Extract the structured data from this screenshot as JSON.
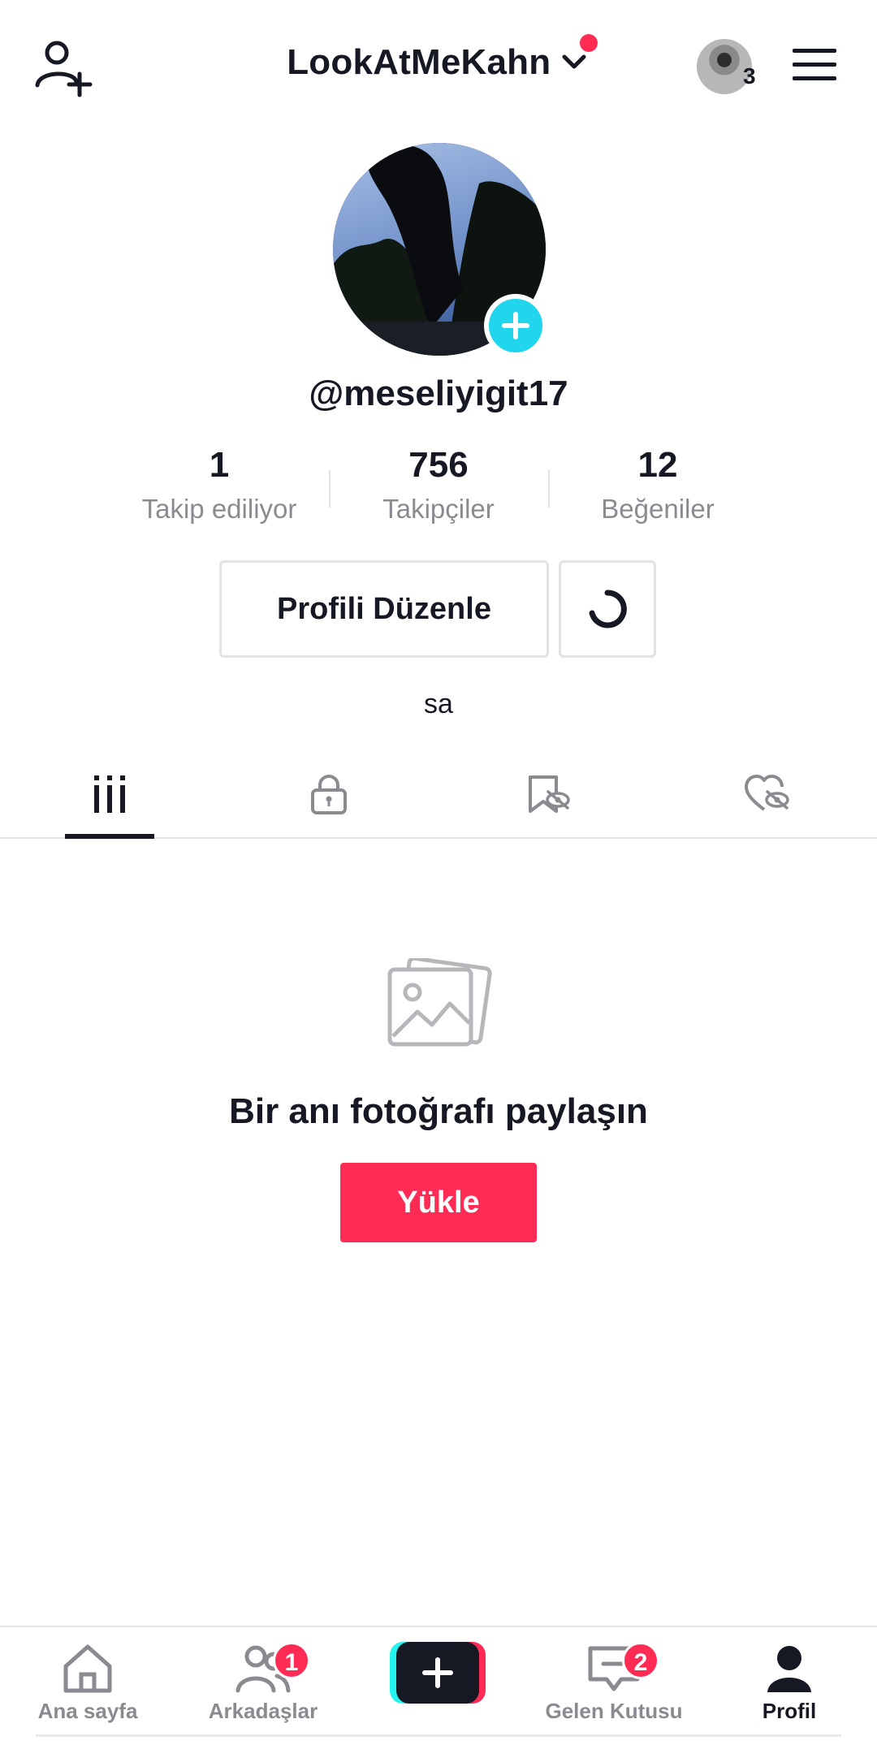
{
  "header": {
    "username": "LookAtMeKahn",
    "account_count": "3"
  },
  "profile": {
    "handle": "@meseliyigit17",
    "bio": "sa"
  },
  "stats": [
    {
      "value": "1",
      "label": "Takip ediliyor"
    },
    {
      "value": "756",
      "label": "Takipçiler"
    },
    {
      "value": "12",
      "label": "Beğeniler"
    }
  ],
  "actions": {
    "edit_profile": "Profili Düzenle"
  },
  "tabs": [
    "videos-grid-icon",
    "lock-icon",
    "bookmark-hidden-icon",
    "liked-hidden-icon"
  ],
  "empty_state": {
    "title": "Bir anı fotoğrafı paylaşın",
    "upload_label": "Yükle"
  },
  "bottom_nav": {
    "home": "Ana sayfa",
    "friends": "Arkadaşlar",
    "friends_badge": "1",
    "inbox": "Gelen Kutusu",
    "inbox_badge": "2",
    "profile": "Profil"
  },
  "colors": {
    "accent": "#fe2c55",
    "cyan": "#20d5ec",
    "text": "#161823",
    "muted": "#8a8b91"
  }
}
